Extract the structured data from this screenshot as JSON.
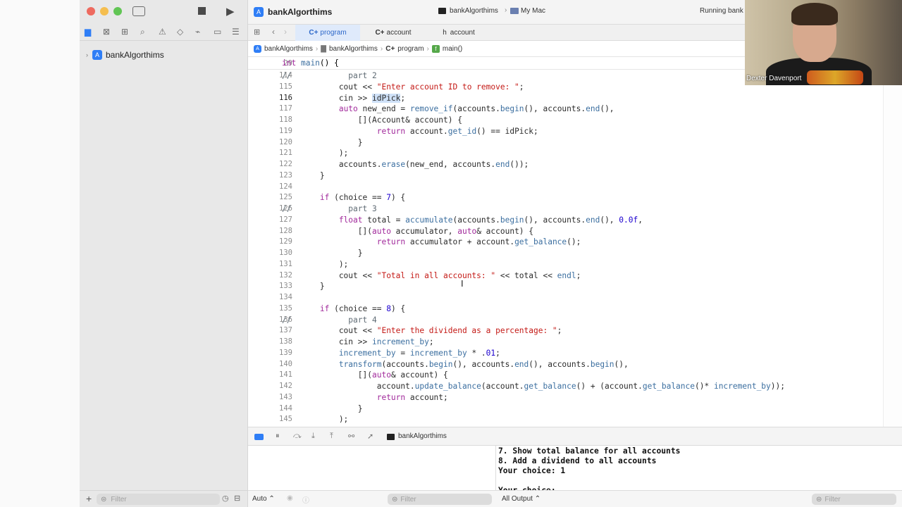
{
  "window": {
    "title": "bankAlgorthims",
    "scheme": "bankAlgorthims",
    "destination": "My Mac",
    "status": "Running bank"
  },
  "sidebar": {
    "project": "bankAlgorthims",
    "filter_placeholder": "Filter"
  },
  "tabs": [
    {
      "label": "program",
      "prefix": "C+"
    },
    {
      "label": "account",
      "prefix": "C+"
    },
    {
      "label": "account",
      "prefix": "h"
    }
  ],
  "jumpbar": [
    "bankAlgorthims",
    "bankAlgorthims",
    "program",
    "main()"
  ],
  "sticky": {
    "ln": "29",
    "code": "int main() {"
  },
  "code_lines": [
    {
      "ln": "114",
      "code": "//            part 2"
    },
    {
      "ln": "115",
      "code": "            cout << \"Enter account ID to remove: \";"
    },
    {
      "ln": "116",
      "code": "            cin >> idPick;"
    },
    {
      "ln": "117",
      "code": "            auto new_end = remove_if(accounts.begin(), accounts.end(),"
    },
    {
      "ln": "118",
      "code": "                [](Account& account) {"
    },
    {
      "ln": "119",
      "code": "                    return account.get_id() == idPick;"
    },
    {
      "ln": "120",
      "code": "                }"
    },
    {
      "ln": "121",
      "code": "            );"
    },
    {
      "ln": "122",
      "code": "            accounts.erase(new_end, accounts.end());"
    },
    {
      "ln": "123",
      "code": "        }"
    },
    {
      "ln": "124",
      "code": ""
    },
    {
      "ln": "125",
      "code": "        if (choice == 7) {"
    },
    {
      "ln": "126",
      "code": "//            part 3"
    },
    {
      "ln": "127",
      "code": "            float total = accumulate(accounts.begin(), accounts.end(), 0.0f,"
    },
    {
      "ln": "128",
      "code": "                [](auto accumulator, auto& account) {"
    },
    {
      "ln": "129",
      "code": "                    return accumulator + account.get_balance();"
    },
    {
      "ln": "130",
      "code": "                }"
    },
    {
      "ln": "131",
      "code": "            );"
    },
    {
      "ln": "132",
      "code": "            cout << \"Total in all accounts: \" << total << endl;"
    },
    {
      "ln": "133",
      "code": "        }"
    },
    {
      "ln": "134",
      "code": ""
    },
    {
      "ln": "135",
      "code": "        if (choice == 8) {"
    },
    {
      "ln": "136",
      "code": "//            part 4"
    },
    {
      "ln": "137",
      "code": "            cout << \"Enter the dividend as a percentage: \";"
    },
    {
      "ln": "138",
      "code": "            cin >> increment_by;"
    },
    {
      "ln": "139",
      "code": "            increment_by = increment_by * .01;"
    },
    {
      "ln": "140",
      "code": "            transform(accounts.begin(), accounts.end(), accounts.begin(),"
    },
    {
      "ln": "141",
      "code": "                [](auto& account) {"
    },
    {
      "ln": "142",
      "code": "                    account.update_balance(account.get_balance() + (account.get_balance()* increment_by));"
    },
    {
      "ln": "143",
      "code": "                    return account;"
    },
    {
      "ln": "144",
      "code": "                }"
    },
    {
      "ln": "145",
      "code": "            );"
    }
  ],
  "debug": {
    "target": "bankAlgorthims"
  },
  "console_lines": [
    "7. Show total balance for all accounts",
    "8. Add a dividend to all accounts",
    "Your choice: 1",
    "",
    "Your choice:"
  ],
  "bottom": {
    "auto_label": "Auto",
    "filter_placeholder": "Filter",
    "output_label": "All Output",
    "console_filter_placeholder": "Filter"
  },
  "video": {
    "participant": "Dexter Davenport"
  },
  "colors": {
    "accent": "#2f7ef6",
    "keyword": "#a1299b",
    "string": "#c41a16"
  }
}
